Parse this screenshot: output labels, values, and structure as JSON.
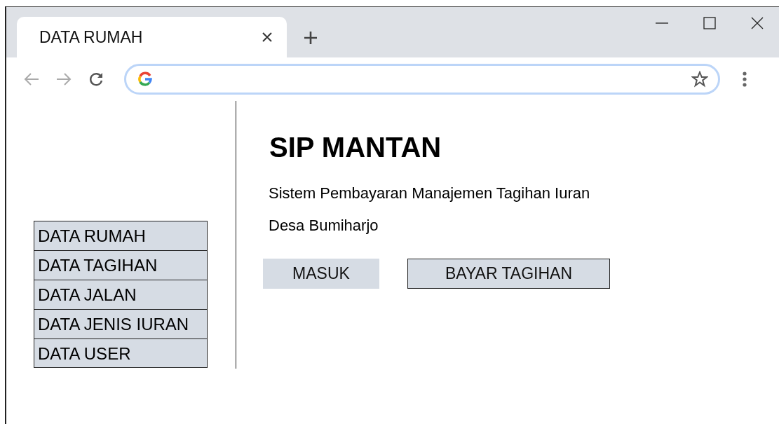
{
  "browser": {
    "tab": {
      "title": "DATA RUMAH",
      "selected": true
    }
  },
  "sidebar": {
    "items": [
      {
        "label": "DATA RUMAH"
      },
      {
        "label": "DATA TAGIHAN"
      },
      {
        "label": "DATA JALAN"
      },
      {
        "label": "DATA JENIS IURAN"
      },
      {
        "label": "DATA USER"
      }
    ]
  },
  "main": {
    "title": "SIP MANTAN",
    "subtitle": [
      "Sistem Pembayaran Manajemen Tagihan Iuran",
      "Desa Bumiharjo"
    ],
    "buttons": [
      {
        "label": "MASUK",
        "kind": "plain"
      },
      {
        "label": "BAYAR TAGIHAN",
        "kind": "outlined"
      }
    ]
  }
}
